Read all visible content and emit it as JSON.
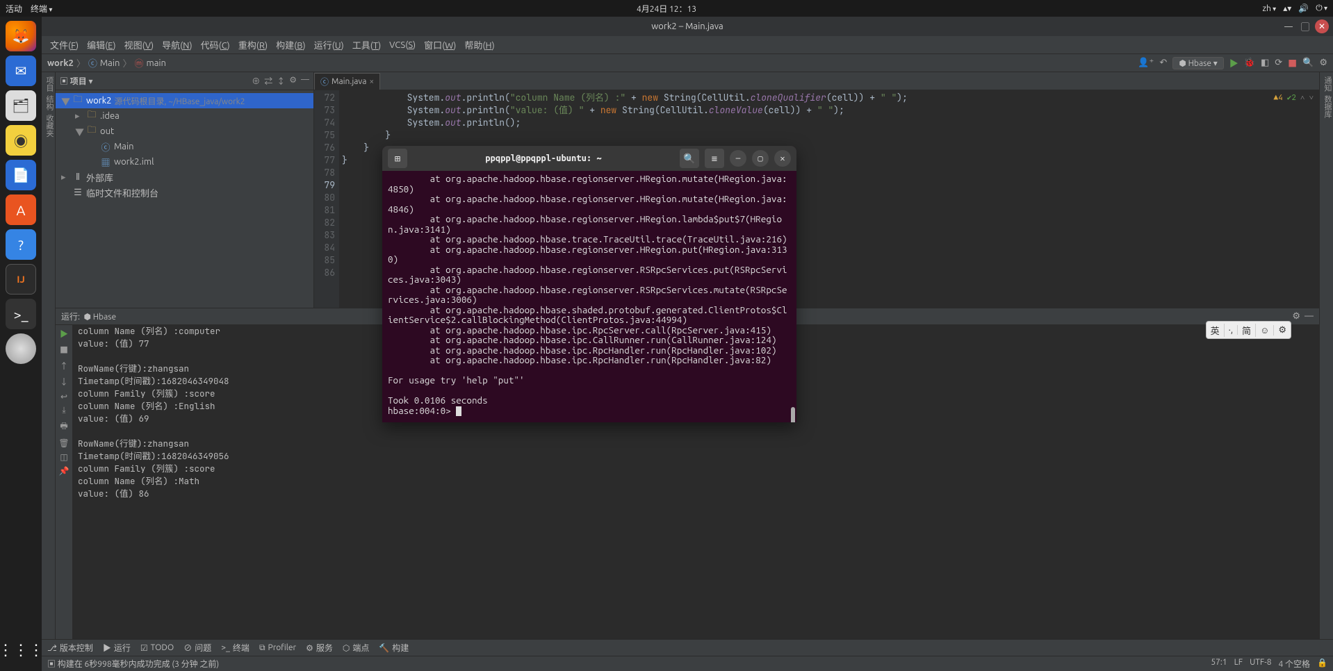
{
  "topbar": {
    "activities": "活动",
    "terminal": "终端",
    "datetime": "4月24日 12：13",
    "lang": "zh"
  },
  "dock": {
    "items": [
      "firefox",
      "mail",
      "files",
      "music",
      "docs",
      "store",
      "help",
      "idea",
      "terminal",
      "disc"
    ]
  },
  "ide": {
    "title": "work2 – Main.java",
    "menu": [
      {
        "l": "文件",
        "k": "F"
      },
      {
        "l": "编辑",
        "k": "E"
      },
      {
        "l": "视图",
        "k": "V"
      },
      {
        "l": "导航",
        "k": "N"
      },
      {
        "l": "代码",
        "k": "C"
      },
      {
        "l": "重构",
        "k": "R"
      },
      {
        "l": "构建",
        "k": "B"
      },
      {
        "l": "运行",
        "k": "U"
      },
      {
        "l": "工具",
        "k": "T"
      },
      {
        "l": "VCS",
        "k": "S"
      },
      {
        "l": "窗口",
        "k": "W"
      },
      {
        "l": "帮助",
        "k": "H"
      }
    ],
    "nav": {
      "project": "work2",
      "crumbs": [
        "Main",
        "main"
      ],
      "run_config": "Hbase"
    },
    "warn": {
      "w": "4",
      "ok": "2"
    },
    "project_pane": {
      "title": "项目",
      "rows": [
        {
          "d": 0,
          "exp": "▼",
          "ic": "folder",
          "name": "work2",
          "extra": " 源代码根目录, ~/HBase_java/work2",
          "sel": true
        },
        {
          "d": 1,
          "exp": "▸",
          "ic": "folder",
          "name": ".idea"
        },
        {
          "d": 1,
          "exp": "▼",
          "ic": "folder",
          "name": "out"
        },
        {
          "d": 2,
          "exp": "",
          "ic": "class",
          "name": "Main"
        },
        {
          "d": 2,
          "exp": "",
          "ic": "file",
          "name": "work2.iml"
        },
        {
          "d": 0,
          "exp": "▸",
          "ic": "lib",
          "name": "外部库"
        },
        {
          "d": 0,
          "exp": "",
          "ic": "scratch",
          "name": "临时文件和控制台"
        }
      ]
    },
    "editor": {
      "tab": "Main.java",
      "first_line": 72,
      "lines": [
        "            System.<f>out</f>.println(<s>\"column Name (列名) :\"</s> + <k>new</k> String(CellUtil.<f>cloneQualifier</f>(cell)) + <s>\" \"</s>);",
        "            System.<f>out</f>.println(<s>\"value: (值) \"</s> + <k>new</k> String(CellUtil.<f>cloneValue</f>(cell)) + <s>\" \"</s>);",
        "            System.<f>out</f>.println();",
        "        }",
        "    }",
        "}",
        "",
        "",
        "",
        "",
        "",
        "",
        "",
        "",
        ""
      ],
      "run_marker_line": 77
    },
    "run_pane": {
      "title": "运行:",
      "config": "Hbase",
      "lines": [
        "column Name (列名) :computer",
        "value: (值) 77",
        "",
        "RowName(行键):zhangsan",
        "Timetamp(时间戳):1682046349048",
        "column Family (列簇) :score",
        "column Name (列名) :English",
        "value: (值) 69",
        "",
        "RowName(行键):zhangsan",
        "Timetamp(时间戳):1682046349056",
        "column Family (列簇) :score",
        "column Name (列名) :Math",
        "value: (值) 86",
        ""
      ]
    },
    "bottom_tabs": [
      "版本控制",
      "运行",
      "TODO",
      "问题",
      "终端",
      "Profiler",
      "服务",
      "端点",
      "构建"
    ],
    "status": {
      "msg": "构建在 6秒998毫秒内成功完成 (3 分钟 之前)",
      "pos": "57:1",
      "enc": "LF",
      "charset": "UTF-8",
      "indent": "4 个空格"
    }
  },
  "terminal": {
    "title": "ppqppl@ppqppl-ubuntu: ~",
    "lines": [
      "        at org.apache.hadoop.hbase.regionserver.HRegion.mutate(HRegion.java:4850)",
      "        at org.apache.hadoop.hbase.regionserver.HRegion.mutate(HRegion.java:4846)",
      "        at org.apache.hadoop.hbase.regionserver.HRegion.lambda$put$7(HRegion.java:3141)",
      "        at org.apache.hadoop.hbase.trace.TraceUtil.trace(TraceUtil.java:216)",
      "        at org.apache.hadoop.hbase.regionserver.HRegion.put(HRegion.java:3130)",
      "        at org.apache.hadoop.hbase.regionserver.RSRpcServices.put(RSRpcServices.java:3043)",
      "        at org.apache.hadoop.hbase.regionserver.RSRpcServices.mutate(RSRpcServices.java:3006)",
      "        at org.apache.hadoop.hbase.shaded.protobuf.generated.ClientProtos$ClientService$2.callBlockingMethod(ClientProtos.java:44994)",
      "        at org.apache.hadoop.hbase.ipc.RpcServer.call(RpcServer.java:415)",
      "        at org.apache.hadoop.hbase.ipc.CallRunner.run(CallRunner.java:124)",
      "        at org.apache.hadoop.hbase.ipc.RpcHandler.run(RpcHandler.java:102)",
      "        at org.apache.hadoop.hbase.ipc.RpcHandler.run(RpcHandler.java:82)",
      "",
      "For usage try 'help \"put\"'",
      "",
      "Took 0.0106 seconds",
      "hbase:004:0> "
    ]
  },
  "ime": {
    "items": [
      "英",
      "·,",
      "简",
      "☺",
      "⚙"
    ]
  }
}
